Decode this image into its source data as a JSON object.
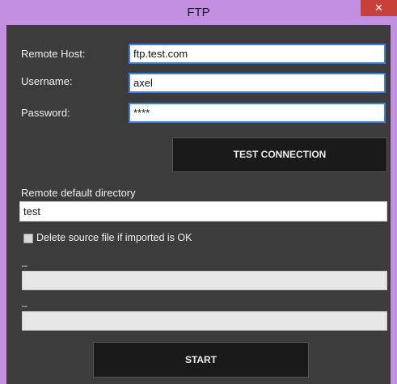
{
  "window": {
    "title": "FTP",
    "close_glyph": "✕"
  },
  "form": {
    "remote_host_label": "Remote Host:",
    "remote_host_value": "ftp.test.com",
    "username_label": "Username:",
    "username_value": "axel",
    "password_label": "Password:",
    "password_value": "****",
    "test_connection_label": "TEST CONNECTION",
    "remote_dir_label": "Remote default directory",
    "remote_dir_value": "test",
    "delete_source_label": "Delete source file if imported is OK",
    "delete_source_checked": false
  },
  "progress": {
    "bar1_label": "_",
    "bar1_value": 0,
    "bar2_label": "_",
    "bar2_value": 0
  },
  "actions": {
    "start_label": "START"
  },
  "colors": {
    "frame": "#c38fe0",
    "client": "#3c3c3c",
    "close": "#c7413a",
    "focus_border": "#3d7fe0",
    "button_bg": "#1a1a1a"
  }
}
